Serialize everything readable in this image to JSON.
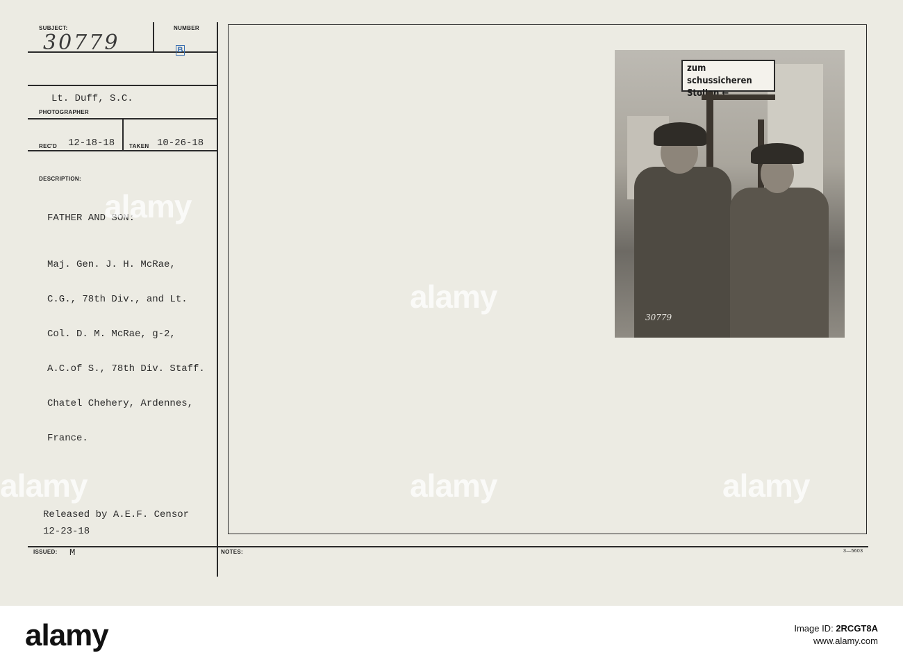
{
  "card": {
    "subject_label": "SUBJECT:",
    "subject_value": "30779",
    "number_label": "NUMBER",
    "number_mark": "B",
    "photographer_value": "Lt. Duff, S.C.",
    "photographer_label": "PHOTOGRAPHER",
    "recd_label": "REC'D",
    "recd_value": "12-18-18",
    "taken_label": "TAKEN",
    "taken_value": "10-26-18",
    "description_label": "DESCRIPTION:",
    "description_heading": "FATHER AND SON:",
    "description_lines": [
      "Maj. Gen. J. H. McRae,",
      "C.G., 78th Div., and Lt.",
      "Col. D. M. McRae, g-2,",
      "A.C.of S., 78th Div. Staff.",
      "Chatel Chehery, Ardennes,",
      "France."
    ],
    "release_line": "Released by A.E.F. Censor",
    "release_date": "12-23-18",
    "issued_label": "ISSUED:",
    "issued_value": "M",
    "notes_label": "NOTES:",
    "form_code": "3—5603"
  },
  "photo": {
    "sign_line1": "zum schussicheren",
    "sign_line2": "Stollen ←",
    "stamp_number": "30779"
  },
  "watermark": {
    "text": "alamy"
  },
  "footer": {
    "logo": "alamy",
    "image_id_label": "Image ID:",
    "image_id": "2RCGT8A",
    "site": "www.alamy.com"
  }
}
